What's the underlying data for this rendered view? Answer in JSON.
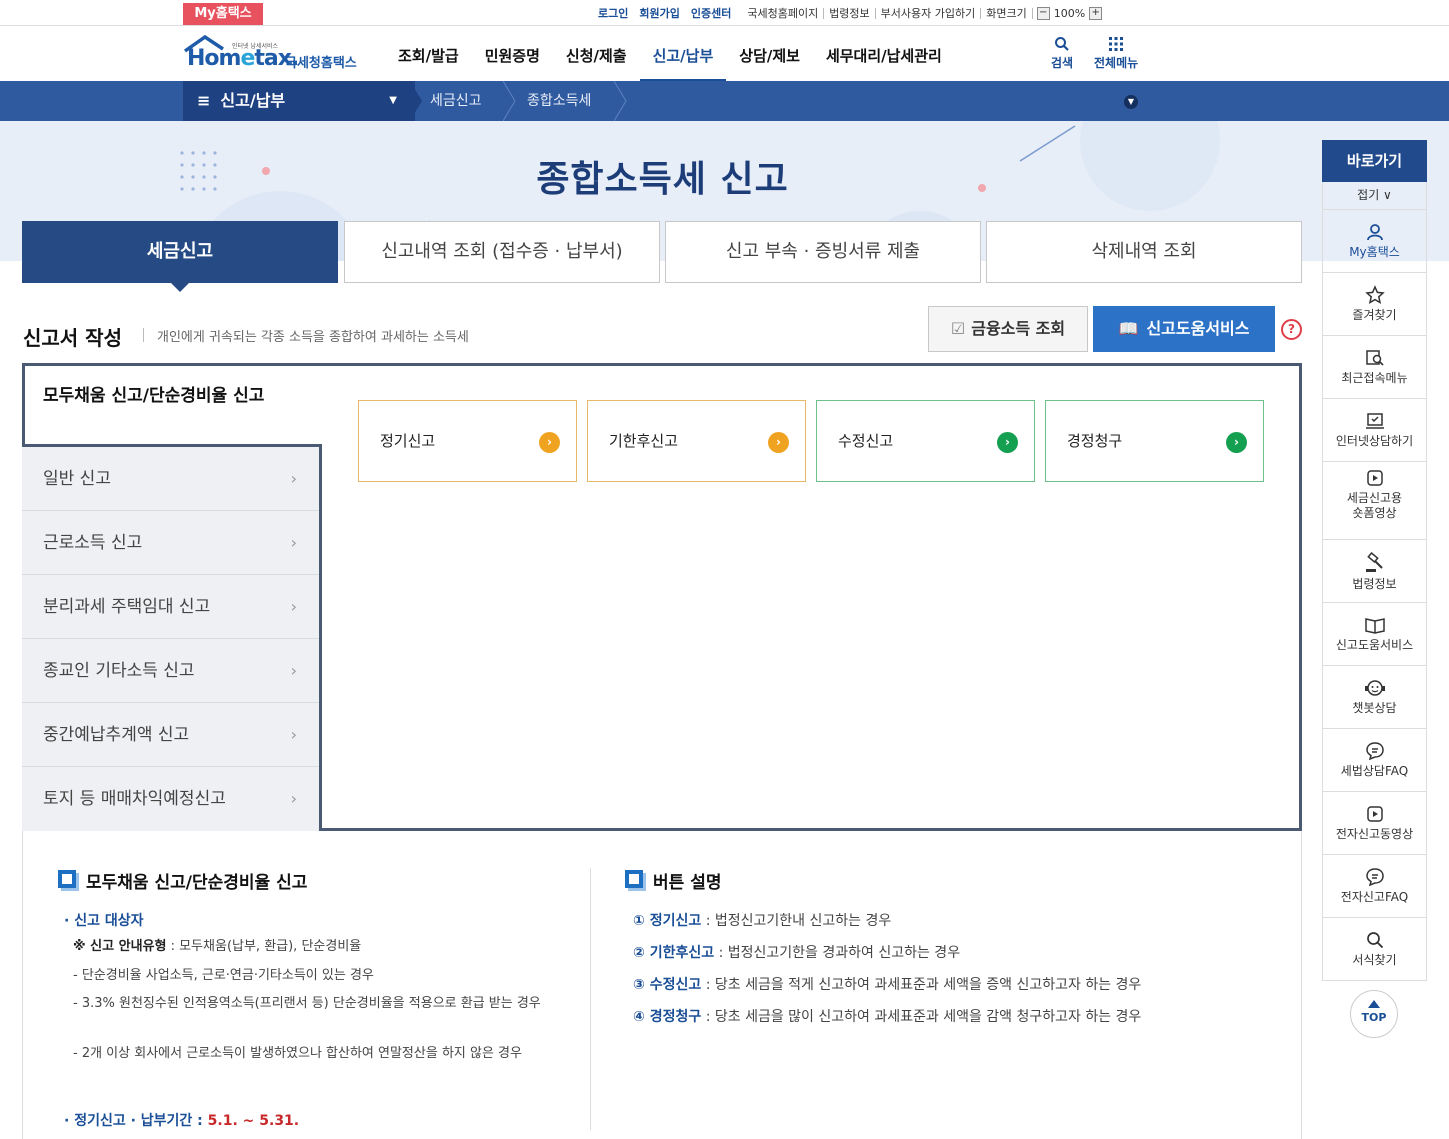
{
  "util": {
    "myhome": "My홈택스",
    "login": "로그인",
    "join": "회원가입",
    "cert": "인증센터",
    "links": [
      "국세청홈페이지",
      "법령정보",
      "부서사용자 가입하기",
      "화면크기"
    ],
    "zoom_minus": "−",
    "zoom_value": "100%",
    "zoom_plus": "+"
  },
  "logo": {
    "sub": "인터넷 납세서비스",
    "main_a": "Hom",
    "main_e": "e",
    "main_b": "tax.",
    "kor": "국세청홈택스"
  },
  "nav": [
    "조회/발급",
    "민원증명",
    "신청/제출",
    "신고/납부",
    "상담/제보",
    "세무대리/납세관리"
  ],
  "gnb_icons": {
    "search": "검색",
    "allmenu": "전체메뉴"
  },
  "crumb": {
    "menu": "신고/납부",
    "c1": "세금신고",
    "c2": "종합소득세"
  },
  "hero_title": "종합소득세 신고",
  "tabs": [
    "세금신고",
    "신고내역 조회 (접수증 · 납부서)",
    "신고 부속 · 증빙서류 제출",
    "삭제내역 조회"
  ],
  "section": {
    "title": "신고서 작성",
    "desc": "개인에게 귀속되는 각종 소득을 종합하여 과세하는 소득세"
  },
  "buttons": {
    "fin": "금융소득 조회",
    "help": "신고도움서비스",
    "q": "?"
  },
  "side": {
    "head": "모두채움 신고/단순경비율 신고",
    "items": [
      "일반 신고",
      "근로소득 신고",
      "분리과세 주택임대 신고",
      "종교인 기타소득 신고",
      "중간예납추계액 신고",
      "토지 등 매매차익예정신고"
    ]
  },
  "cards": [
    {
      "label": "정기신고",
      "color": "#f0a320",
      "border": "#e8b86a"
    },
    {
      "label": "기한후신고",
      "color": "#f0a320",
      "border": "#e8b86a"
    },
    {
      "label": "수정신고",
      "color": "#14a050",
      "border": "#6cc08a"
    },
    {
      "label": "경정청구",
      "color": "#14a050",
      "border": "#6cc08a"
    }
  ],
  "info_left": {
    "title": "모두채움 신고/단순경비율 신고",
    "target_title": "신고 대상자",
    "type_label": "※ 신고 안내유형",
    "type_value": " : 모두채움(납부, 환급), 단순경비율",
    "lines": [
      "- 단순경비율 사업소득, 근로·연금·기타소득이 있는 경우",
      "- 3.3% 원천징수된 인적용역소득(프리랜서 등) 단순경비율을 적용으로 환급 받는 경우",
      "- 2개 이상 회사에서 근로소득이 발생하였으나 합산하여 연말정산을 하지 않은 경우"
    ],
    "period_label": "정기신고 · 납부기간 : ",
    "period_value": "5.1. ~ 5.31."
  },
  "info_right": {
    "title": "버튼 설명",
    "items": [
      {
        "k": "① 정기신고",
        "v": " : 법정신고기한내 신고하는 경우"
      },
      {
        "k": "② 기한후신고",
        "v": " : 법정신고기한을 경과하여 신고하는 경우"
      },
      {
        "k": "③ 수정신고",
        "v": " : 당초 세금을 적게 신고하여 과세표준과 세액을 증액 신고하고자 하는 경우"
      },
      {
        "k": "④ 경정청구",
        "v": " : 당초 세금을 많이 신고하여 과세표준과 세액을 감액 청구하고자 하는 경우"
      }
    ]
  },
  "right_bar": {
    "head": "바로가기",
    "fold": "접기 ∨",
    "items": [
      "My홈택스",
      "즐겨찾기",
      "최근접속메뉴",
      "인터넷상담하기",
      "세금신고용 숏폼영상",
      "법령정보",
      "신고도움서비스",
      "챗봇상담",
      "세법상담FAQ",
      "전자신고동영상",
      "전자신고FAQ",
      "서식찾기"
    ],
    "top": "TOP"
  }
}
